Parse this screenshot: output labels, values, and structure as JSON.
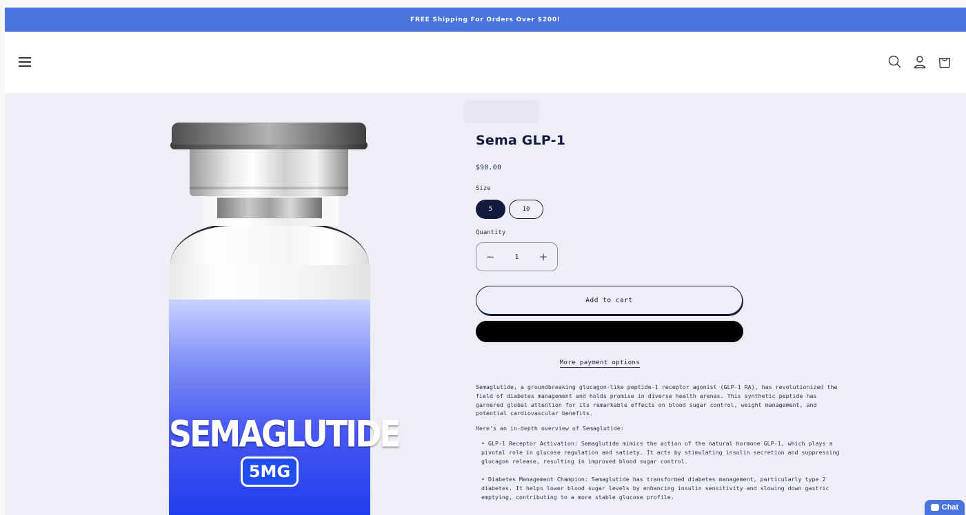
{
  "announcement": {
    "text": "FREE Shipping For Orders Over $200!"
  },
  "header": {
    "icons": [
      "menu-icon",
      "search-icon",
      "account-icon",
      "cart-icon"
    ]
  },
  "product": {
    "title": "Sema GLP-1",
    "price": "$90.00",
    "image": {
      "name": "SEMAGLUTIDE",
      "dose": "5MG"
    },
    "size": {
      "label": "Size",
      "options": [
        "5",
        "10"
      ],
      "selected": "5"
    },
    "quantity": {
      "label": "Quantity",
      "value": "1",
      "minus": "−",
      "plus": "+"
    },
    "add_to_cart": "Add to cart",
    "more_payment": "More payment options",
    "description": {
      "intro": "Semaglutide, a groundbreaking glucagon-like peptide-1 receptor agonist (GLP-1 RA), has revolutionized the field of diabetes management and holds promise in diverse health arenas. This synthetic peptide has garnered global attention for its remarkable effects on blood sugar control, weight management, and potential cardiovascular benefits.",
      "overview": "Here's an in-depth overview of Semaglutide:",
      "bullet1": "• GLP-1 Receptor Activation: Semaglutide mimics the action of the natural hormone GLP-1, which plays a pivotal role in glucose regulation and satiety. It acts by stimulating insulin secretion and suppressing glucagon release, resulting in improved blood sugar control.",
      "bullet2": "• Diabetes Management Champion: Semaglutide has transformed diabetes management, particularly type 2 diabetes. It helps lower blood sugar levels by enhancing insulin sensitivity and slowing down gastric emptying, contributing to a more stable glucose profile."
    }
  },
  "chat": {
    "label": "Chat"
  },
  "colors": {
    "accent": "#4a74dd",
    "primary": "#121b3d",
    "background": "#eeeff6"
  }
}
